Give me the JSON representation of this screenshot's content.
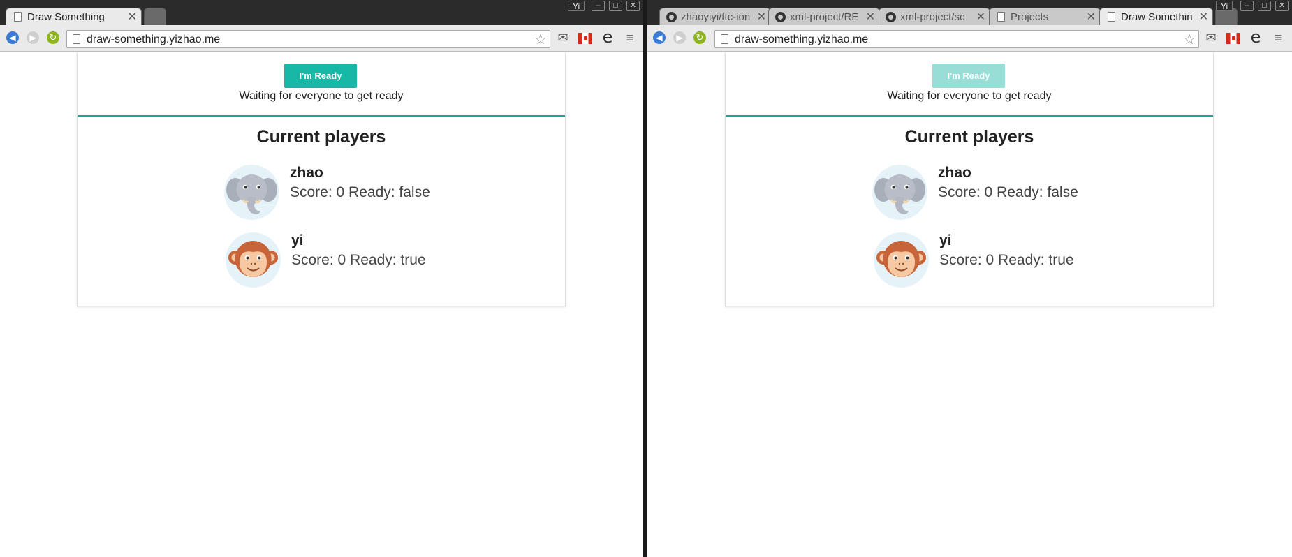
{
  "left": {
    "tabs": [
      {
        "title": "Draw Something",
        "active": true
      }
    ],
    "user_label": "Yi",
    "url": "draw-something.yizhao.me",
    "ready_button": "I'm Ready",
    "ready_disabled": false
  },
  "right": {
    "tabs": [
      {
        "title": "zhaoyiyi/ttc-ion",
        "active": false
      },
      {
        "title": "xml-project/RE",
        "active": false
      },
      {
        "title": "xml-project/sc",
        "active": false
      },
      {
        "title": "Projects",
        "active": false
      },
      {
        "title": "Draw Somethin",
        "active": true
      }
    ],
    "user_label": "Yi",
    "url": "draw-something.yizhao.me",
    "ready_button": "I'm Ready",
    "ready_disabled": true
  },
  "window_buttons": {
    "minimize": "–",
    "maximize": "□",
    "close": "✕"
  },
  "game": {
    "waiting_text": "Waiting for everyone to get ready",
    "players_title": "Current players",
    "players": [
      {
        "name": "zhao",
        "info": "Score: 0 Ready: false",
        "avatar": "elephant-icon"
      },
      {
        "name": "yi",
        "info": "Score: 0 Ready: true",
        "avatar": "monkey-icon"
      }
    ]
  },
  "colors": {
    "accent": "#17b8a6",
    "accent_disabled": "#98ddd6",
    "divider": "#17a697"
  }
}
